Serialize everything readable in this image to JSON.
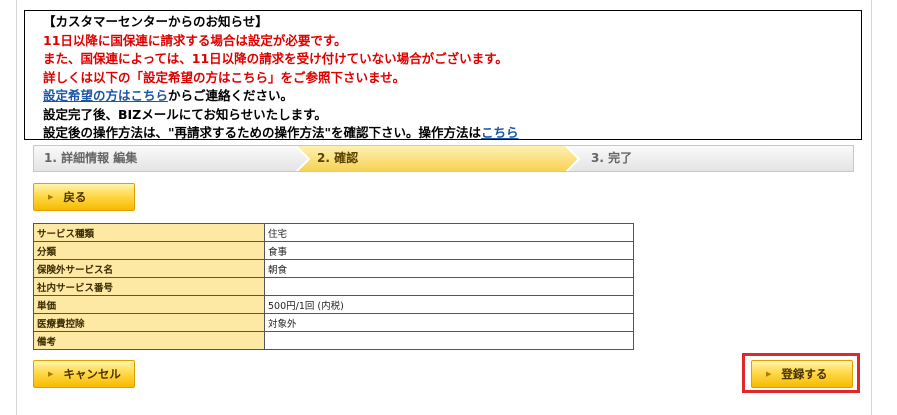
{
  "notice": {
    "title": "【カスタマーセンターからのお知らせ】",
    "line1": "11日以降に国保連に請求する場合は設定が必要です。",
    "line2": "また、国保連によっては、11日以降の請求を受け付けていない場合がございます。",
    "line3": "詳しくは以下の「設定希望の方はこちら」をご参照下さいませ。",
    "line4_link": "設定希望の方はこちら",
    "line4_text": "からご連絡ください。",
    "line5": "設定完了後、BIZメールにてお知らせいたします。",
    "line6_text": "設定後の操作方法は、\"再請求するための操作方法\"を確認下さい。操作方法は",
    "line6_link": "こちら"
  },
  "steps": [
    {
      "label": "1. 詳細情報 編集",
      "active": false
    },
    {
      "label": "2. 確認",
      "active": true
    },
    {
      "label": "3. 完了",
      "active": false
    }
  ],
  "buttons": {
    "back": "戻る",
    "cancel": "キャンセル",
    "register": "登録する"
  },
  "table": [
    {
      "label": "サービス種類",
      "value": "住宅"
    },
    {
      "label": "分類",
      "value": "食事"
    },
    {
      "label": "保険外サービス名",
      "value": "朝食"
    },
    {
      "label": "社内サービス番号",
      "value": ""
    },
    {
      "label": "単価",
      "value": "500円/1回 (内税)"
    },
    {
      "label": "医療費控除",
      "value": "対象外"
    },
    {
      "label": "備考",
      "value": ""
    }
  ],
  "colors": {
    "notice_red": "#e00000",
    "link_blue": "#1a55a8",
    "button_yellow": "#ffd94a",
    "label_bg": "#fde9a4",
    "highlight_red": "#e0282c"
  }
}
